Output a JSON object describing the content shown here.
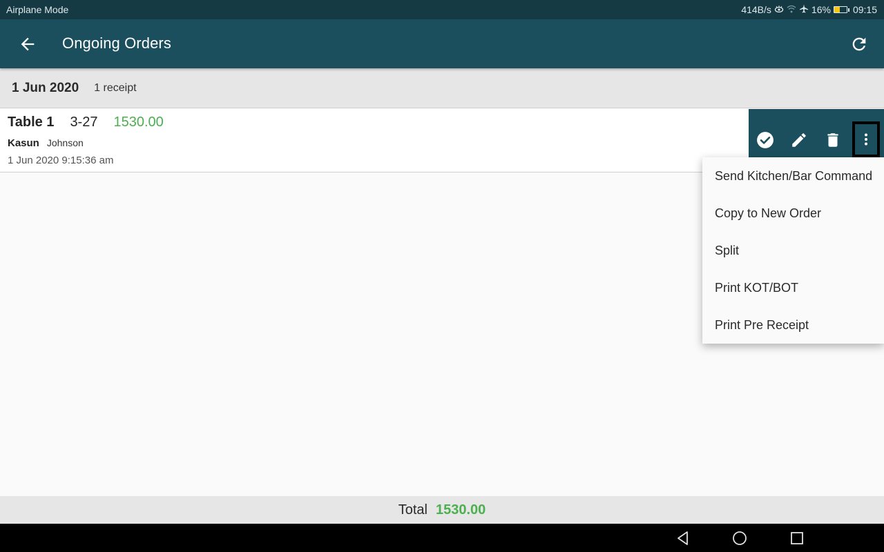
{
  "status_bar": {
    "left_text": "Airplane Mode",
    "net_speed": "414B/s",
    "battery": "16%",
    "time": "09:15"
  },
  "app_bar": {
    "title": "Ongoing Orders",
    "back_icon": "arrow-left-icon",
    "refresh_icon": "refresh-icon"
  },
  "date_group": {
    "date": "1 Jun 2020",
    "count": "1 receipt"
  },
  "orders": [
    {
      "table": "Table 1",
      "number": "3-27",
      "amount": "1530.00",
      "first_name": "Kasun",
      "last_name": "Johnson",
      "time": "1 Jun 2020 9:15:36 am"
    }
  ],
  "row_actions": [
    {
      "name": "complete",
      "icon": "check-circle-icon"
    },
    {
      "name": "edit",
      "icon": "pencil-icon"
    },
    {
      "name": "delete",
      "icon": "trash-icon"
    },
    {
      "name": "more",
      "icon": "more-vertical-icon"
    }
  ],
  "overflow_menu": {
    "items": [
      "Send Kitchen/Bar Command",
      "Copy to New Order",
      "Split",
      "Print KOT/BOT",
      "Print Pre Receipt"
    ]
  },
  "footer": {
    "total_label": "Total",
    "total_value": "1530.00"
  },
  "colors": {
    "primary": "#1b4f5e",
    "status_bar": "#153a44",
    "amount_green": "#4caf50"
  }
}
